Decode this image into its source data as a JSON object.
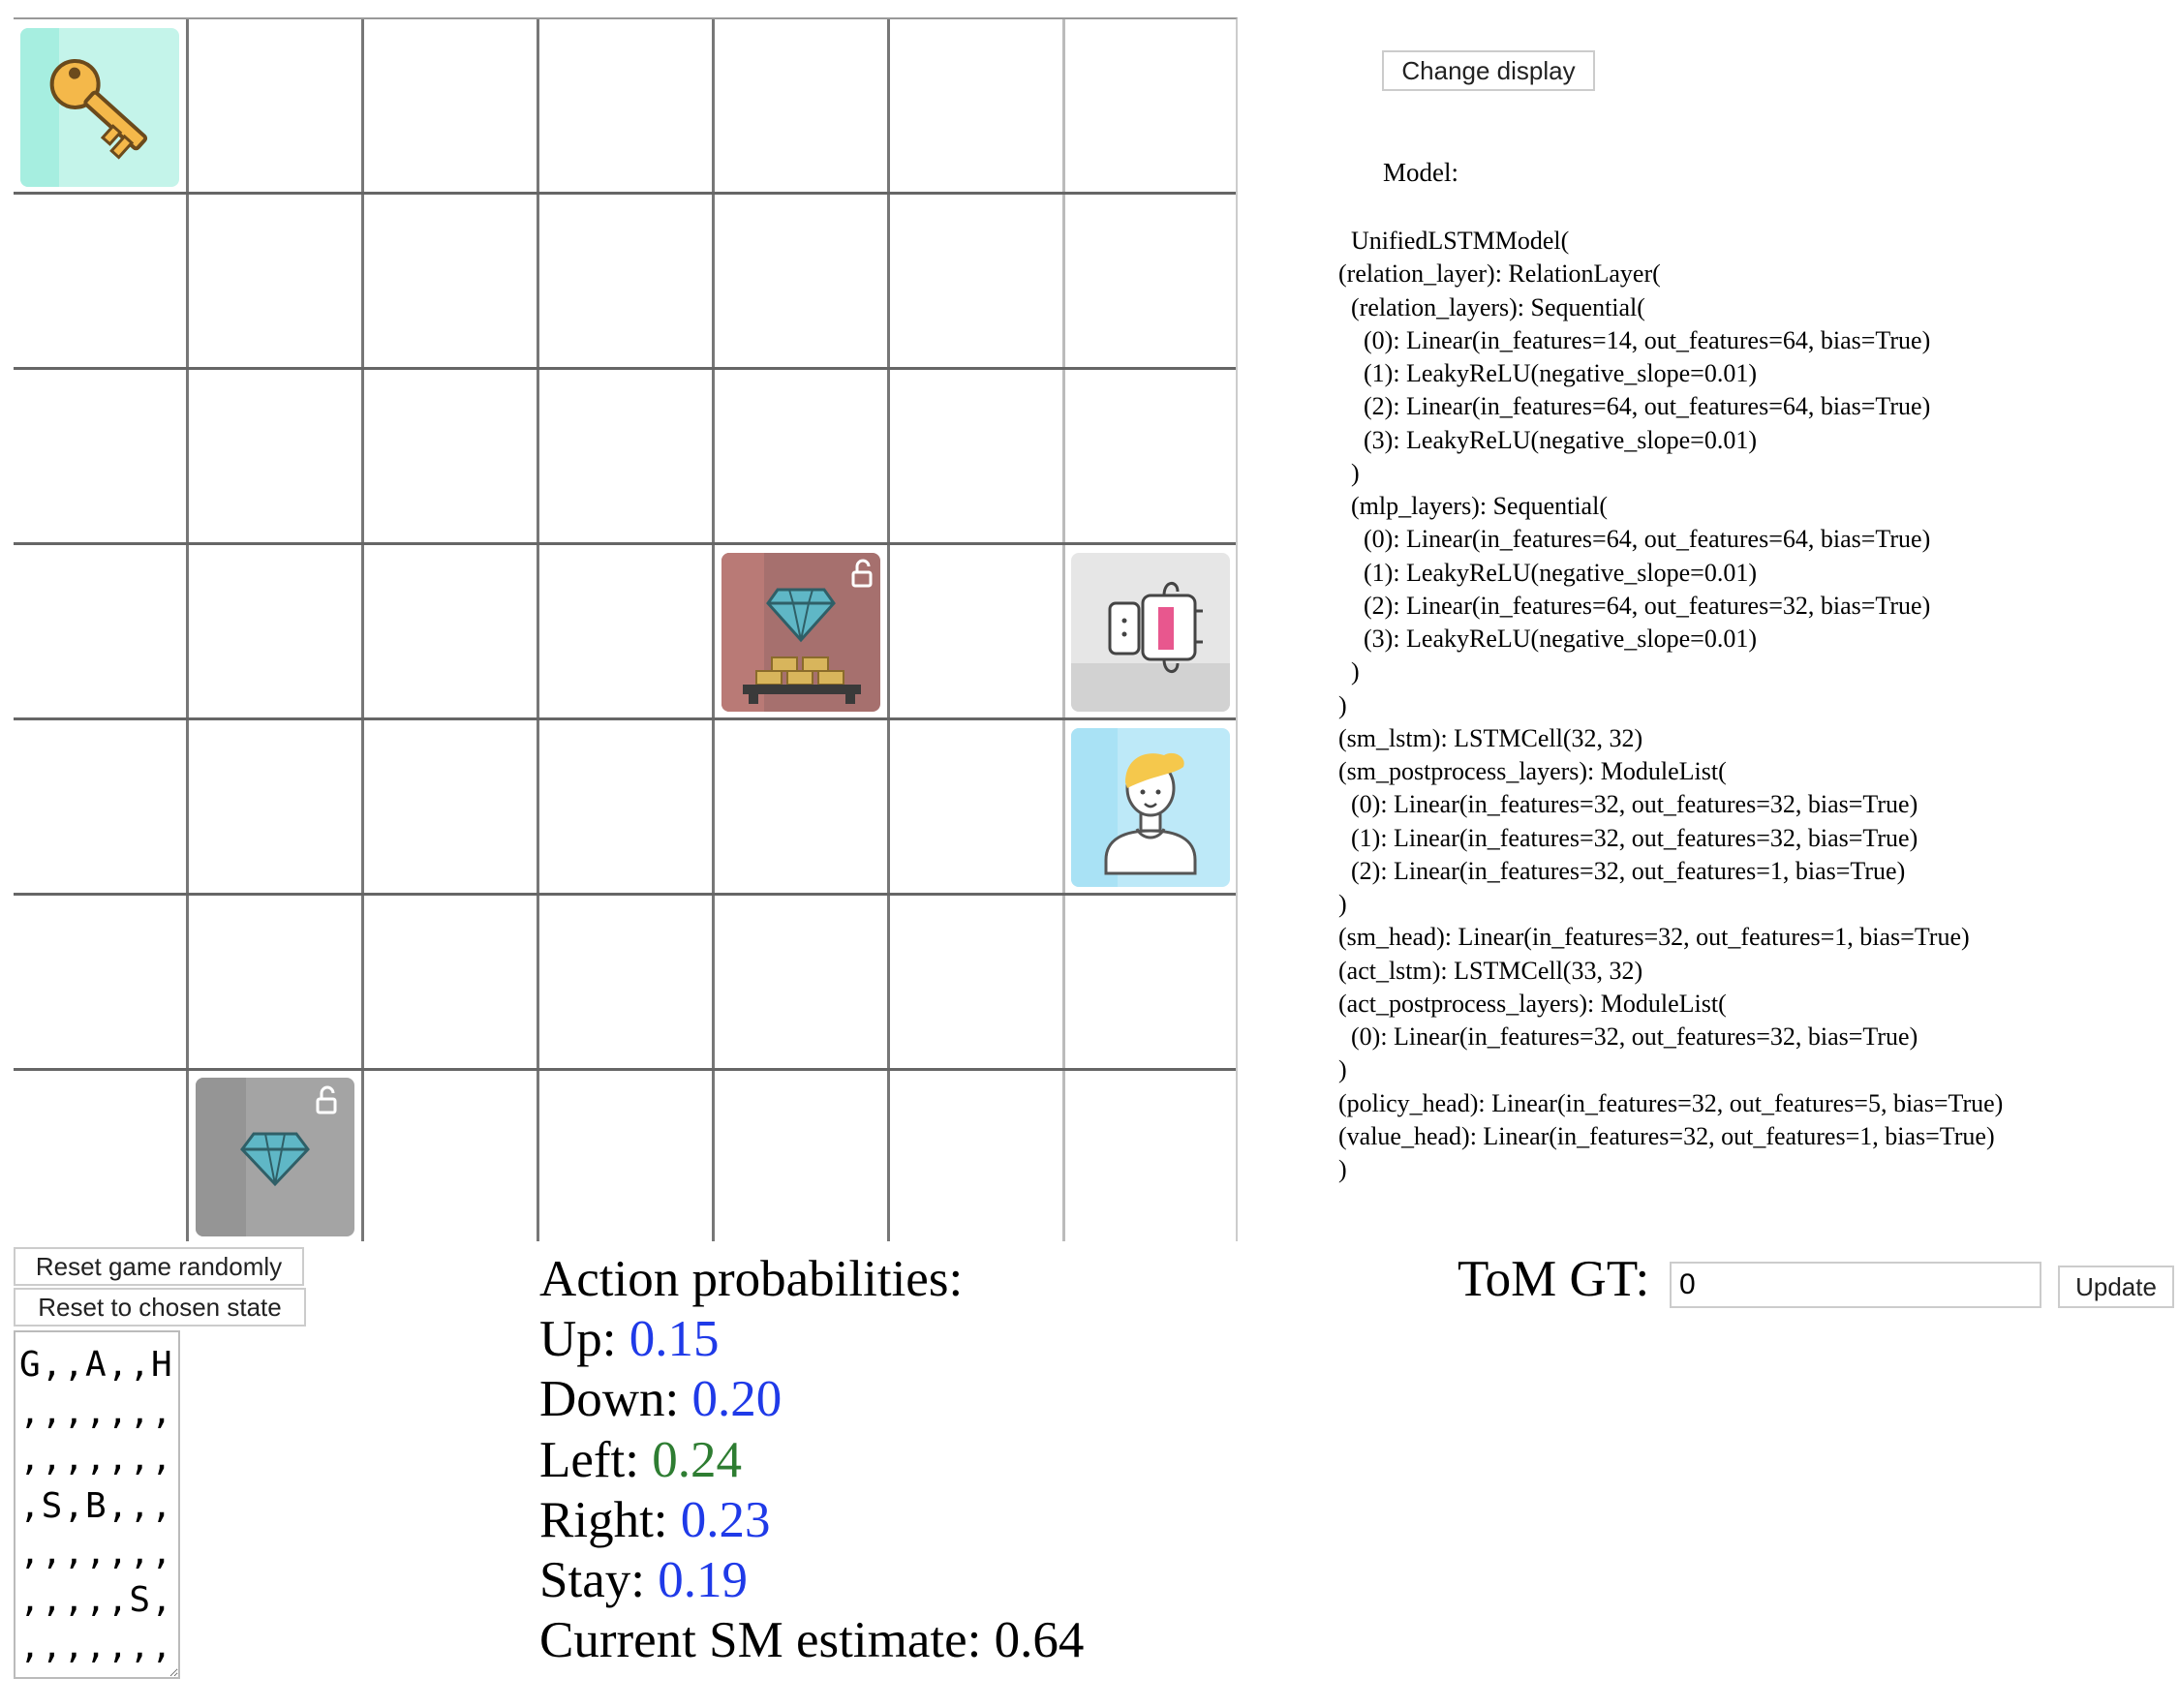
{
  "grid": {
    "rows": 7,
    "cols": 7,
    "cells": [
      {
        "row": 0,
        "col": 0,
        "item": "key-icon",
        "color": "#b7f1e6"
      },
      {
        "row": 3,
        "col": 4,
        "item": "diamond-gold-locked-icon",
        "color": "#a6706e"
      },
      {
        "row": 3,
        "col": 6,
        "item": "robot-icon",
        "color": "#e4e4e4"
      },
      {
        "row": 4,
        "col": 6,
        "item": "human-avatar-icon",
        "color": "#bde9f8"
      },
      {
        "row": 6,
        "col": 1,
        "item": "diamond-locked-icon",
        "color": "#a4a4a4"
      }
    ]
  },
  "right_panel": {
    "change_display_label": "Change display",
    "model_label": "Model:",
    "model_text": "  UnifiedLSTMModel(\n(relation_layer): RelationLayer(\n  (relation_layers): Sequential(\n    (0): Linear(in_features=14, out_features=64, bias=True)\n    (1): LeakyReLU(negative_slope=0.01)\n    (2): Linear(in_features=64, out_features=64, bias=True)\n    (3): LeakyReLU(negative_slope=0.01)\n  )\n  (mlp_layers): Sequential(\n    (0): Linear(in_features=64, out_features=64, bias=True)\n    (1): LeakyReLU(negative_slope=0.01)\n    (2): Linear(in_features=64, out_features=32, bias=True)\n    (3): LeakyReLU(negative_slope=0.01)\n  )\n)\n(sm_lstm): LSTMCell(32, 32)\n(sm_postprocess_layers): ModuleList(\n  (0): Linear(in_features=32, out_features=32, bias=True)\n  (1): Linear(in_features=32, out_features=32, bias=True)\n  (2): Linear(in_features=32, out_features=1, bias=True)\n)\n(sm_head): Linear(in_features=32, out_features=1, bias=True)\n(act_lstm): LSTMCell(33, 32)\n(act_postprocess_layers): ModuleList(\n  (0): Linear(in_features=32, out_features=32, bias=True)\n)\n(policy_head): Linear(in_features=32, out_features=5, bias=True)\n(value_head): Linear(in_features=32, out_features=1, bias=True)\n)"
  },
  "controls": {
    "reset_random_label": "Reset game randomly",
    "reset_chosen_label": "Reset to chosen state",
    "state_text": "G,,A,,H\n,,,,,,,\n,,,,,,,\n,S,B,,,\n,,,,,,,\n,,,,,S,\n,,,,,,,"
  },
  "action_probabilities": {
    "title": "Action probabilities:",
    "up_label": "Up:",
    "up_value": "0.15",
    "down_label": "Down:",
    "down_value": "0.20",
    "left_label": "Left:",
    "left_value": "0.24",
    "right_label": "Right:",
    "right_value": "0.23",
    "stay_label": "Stay:",
    "stay_value": "0.19",
    "sm_label": "Current SM estimate:",
    "sm_value": "0.64",
    "highlight_color": "#2e7d32",
    "value_color": "#1f3ae8"
  },
  "tom": {
    "label": "ToM GT:",
    "value": "0",
    "update_label": "Update"
  }
}
